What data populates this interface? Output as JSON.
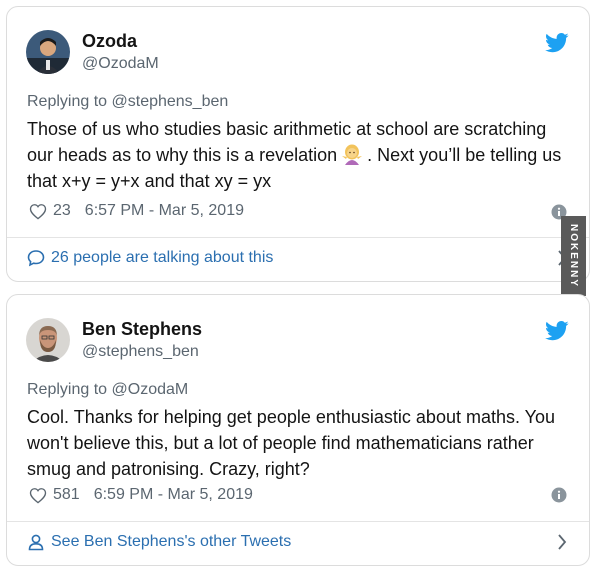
{
  "tweets": [
    {
      "display_name": "Ozoda",
      "handle": "@OzodaM",
      "reply_prefix": "Replying to",
      "reply_to": "@stephens_ben",
      "text_before_emoji": "Those of us who studies basic arithmetic at school are scratching our heads as to why this is a revelation",
      "emoji_icon": "woman-shrugging-emoji",
      "text_after_emoji": ". Next you’ll be telling us that x+y = y+x and that xy = yx",
      "likes": "23",
      "timestamp": "6:57 PM - Mar 5, 2019",
      "footer_link": "26 people are talking about this",
      "footer_icon": "comment-bubble-icon"
    },
    {
      "display_name": "Ben Stephens",
      "handle": "@stephens_ben",
      "reply_prefix": "Replying to",
      "reply_to": "@OzodaM",
      "text": "Cool. Thanks for helping get people enthusiastic about maths. You won't believe this, but a lot of people find mathematicians rather smug and patronising. Crazy, right?",
      "likes": "581",
      "timestamp": "6:59 PM - Mar 5, 2019",
      "footer_link": "See Ben Stephens's other Tweets",
      "footer_icon": "person-icon"
    }
  ],
  "watermark": "NOKENNY",
  "colors": {
    "twitter_blue": "#1da1f2",
    "link_blue": "#2b6fb0",
    "secondary_text": "#5b6670",
    "border": "#dcdcdc"
  }
}
